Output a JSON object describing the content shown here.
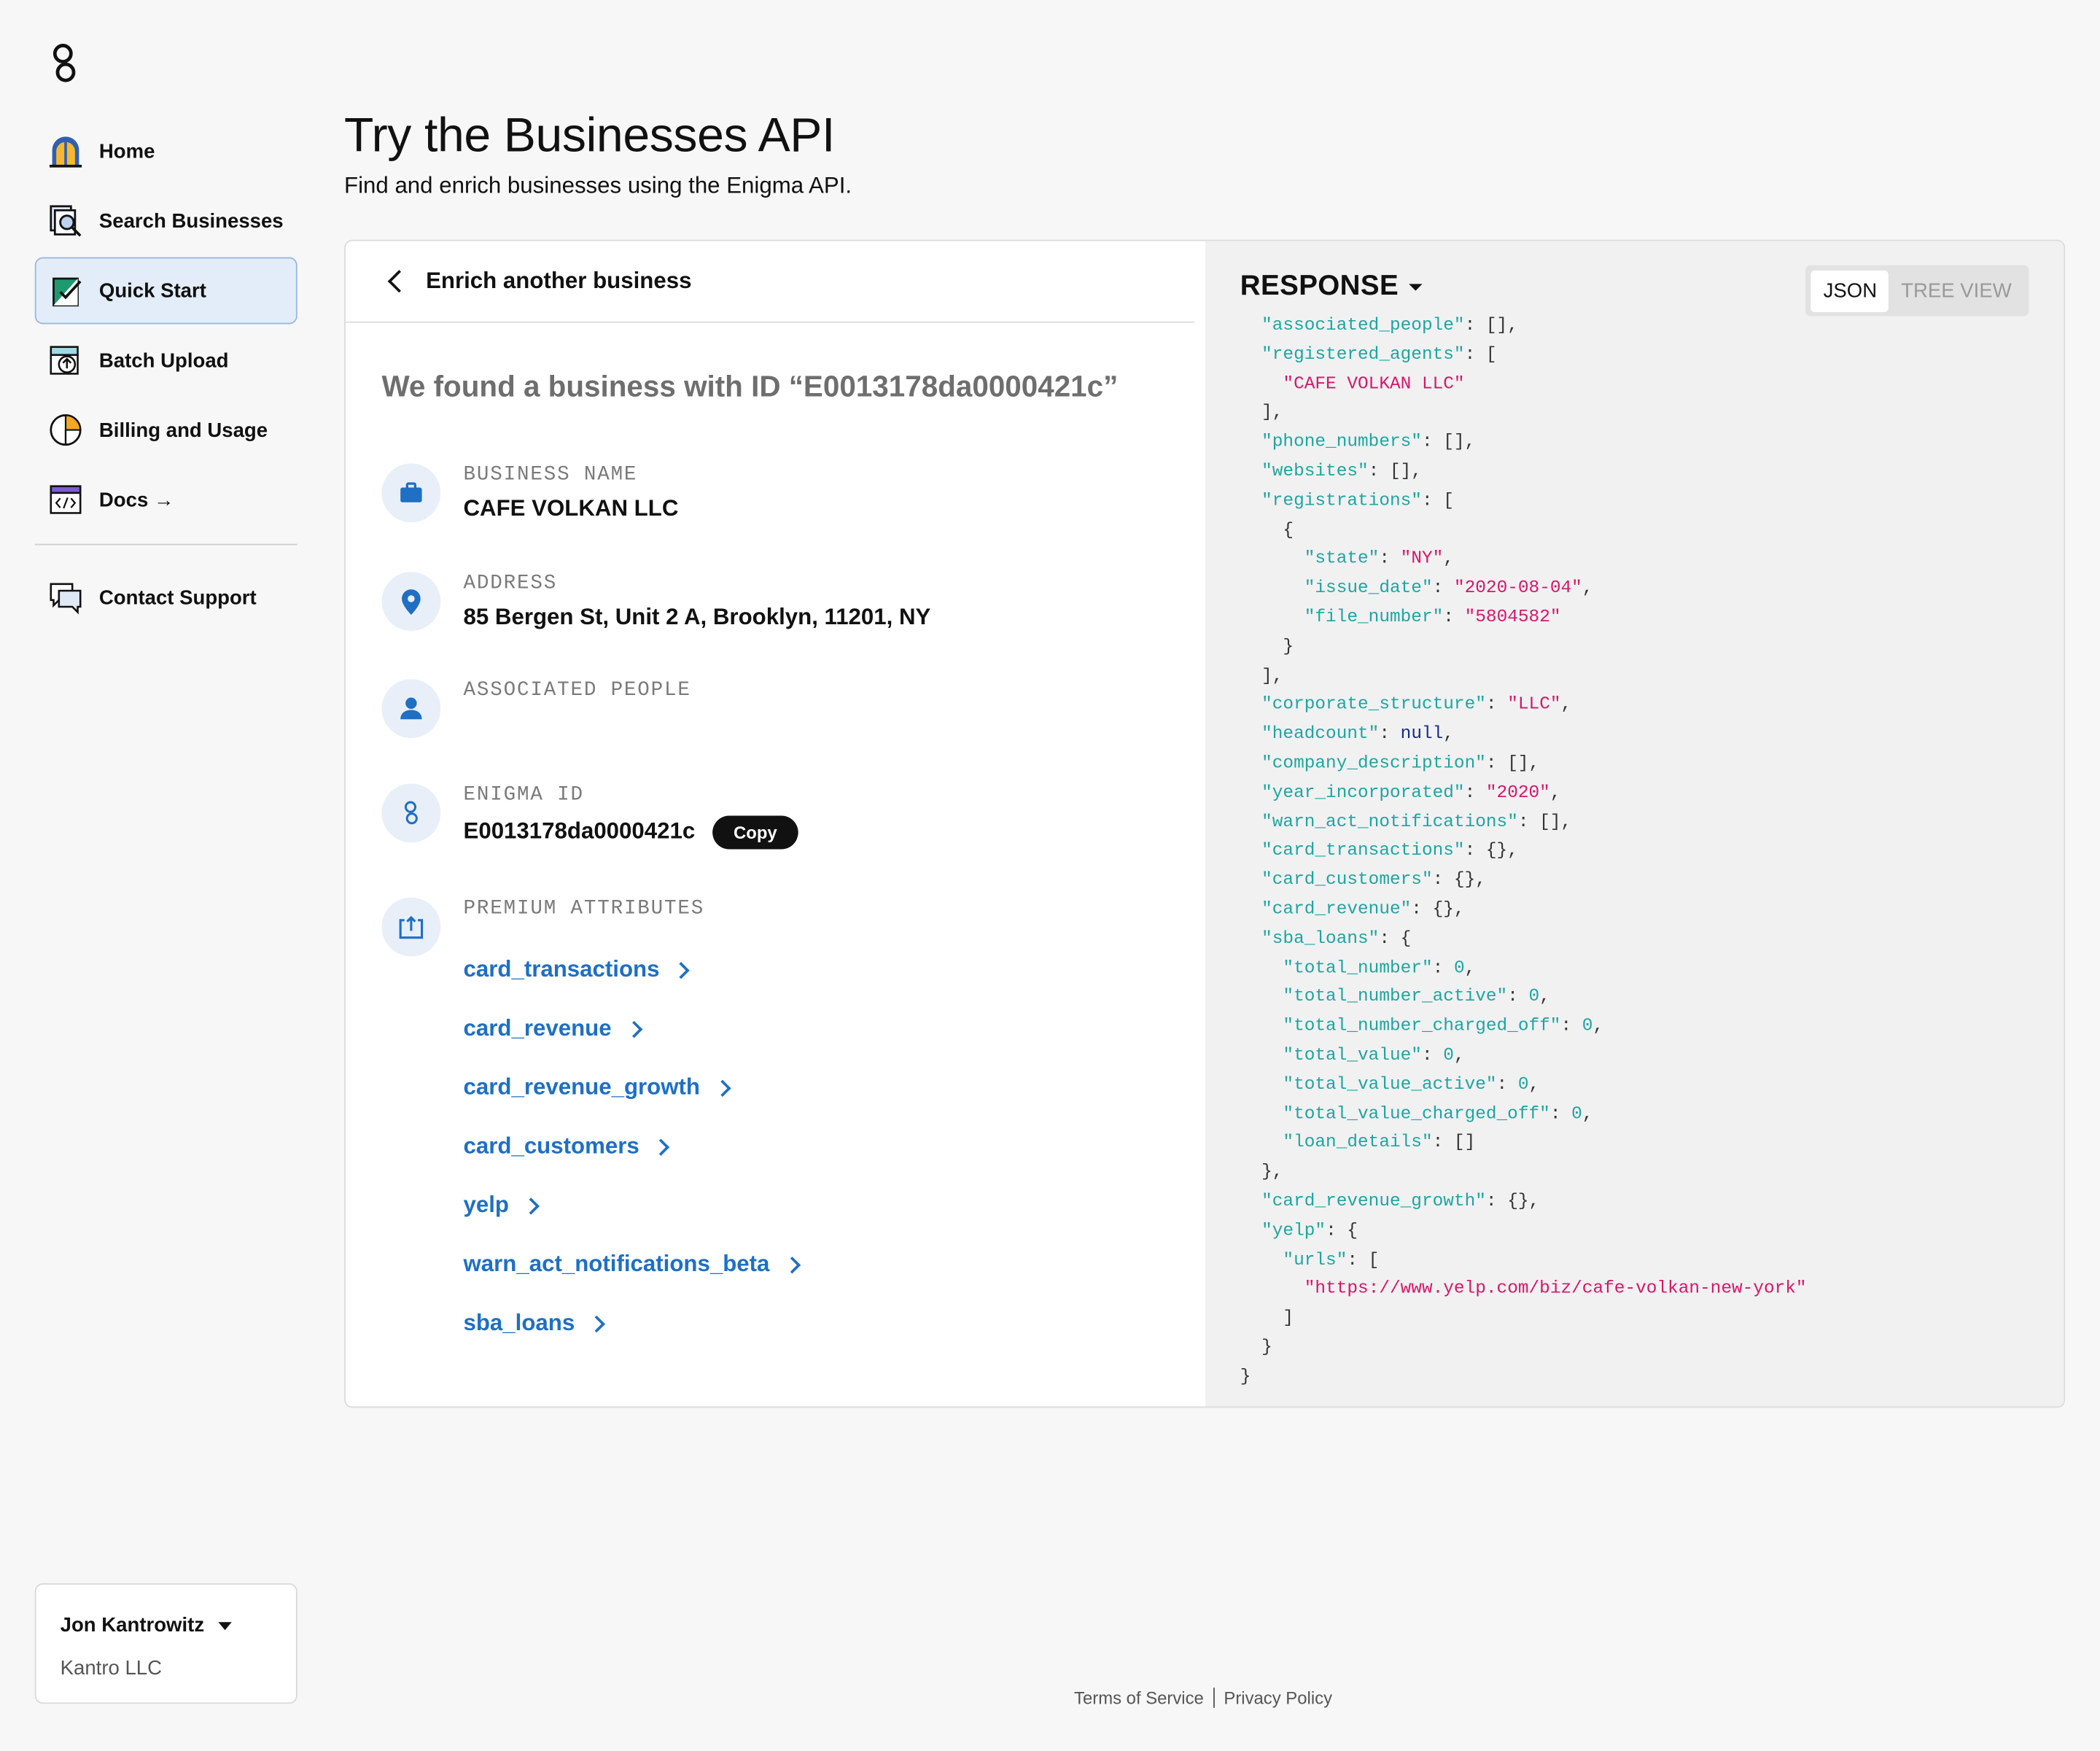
{
  "sidebar": {
    "logo_icon": "enigma-logo-icon",
    "items": [
      {
        "label": "Home",
        "icon": "home-icon"
      },
      {
        "label": "Search Businesses",
        "icon": "search-businesses-icon"
      },
      {
        "label": "Quick Start",
        "icon": "quick-start-icon",
        "active": true
      },
      {
        "label": "Batch Upload",
        "icon": "batch-upload-icon"
      },
      {
        "label": "Billing and Usage",
        "icon": "billing-icon"
      },
      {
        "label": "Docs →",
        "icon": "docs-icon"
      },
      {
        "label": "Contact Support",
        "icon": "contact-support-icon"
      }
    ],
    "user": {
      "name": "Jon Kantrowitz",
      "org": "Kantro LLC"
    }
  },
  "header": {
    "title": "Try the Businesses API",
    "subtitle": "Find and enrich businesses using the Enigma API."
  },
  "result": {
    "back_label": "Enrich another business",
    "found_text": "We found a business with ID “E0013178da0000421c”",
    "fields": {
      "business_name": {
        "label": "BUSINESS NAME",
        "value": "CAFE VOLKAN LLC",
        "icon": "briefcase-icon"
      },
      "address": {
        "label": "ADDRESS",
        "value": "85 Bergen St, Unit 2 A, Brooklyn, 11201, NY",
        "icon": "map-pin-icon"
      },
      "associated_people": {
        "label": "ASSOCIATED PEOPLE",
        "value": "",
        "icon": "person-icon"
      },
      "enigma_id": {
        "label": "ENIGMA ID",
        "value": "E0013178da0000421c",
        "icon": "enigma-id-icon",
        "copy_label": "Copy"
      },
      "premium": {
        "label": "PREMIUM ATTRIBUTES",
        "icon": "premium-attributes-icon"
      }
    },
    "premium_links": [
      "card_transactions",
      "card_revenue",
      "card_revenue_growth",
      "card_customers",
      "yelp",
      "warn_act_notifications_beta",
      "sba_loans"
    ]
  },
  "response": {
    "title": "RESPONSE",
    "toggle": {
      "json": "JSON",
      "tree": "TREE VIEW",
      "selected": "JSON"
    },
    "lines": [
      "  \"associated_people\": [],",
      "  \"registered_agents\": [",
      "    \"CAFE VOLKAN LLC\"",
      "  ],",
      "  \"phone_numbers\": [],",
      "  \"websites\": [],",
      "  \"registrations\": [",
      "    {",
      "      \"state\": \"NY\",",
      "      \"issue_date\": \"2020-08-04\",",
      "      \"file_number\": \"5804582\"",
      "    }",
      "  ],",
      "  \"corporate_structure\": \"LLC\",",
      "  \"headcount\": null,",
      "  \"company_description\": [],",
      "  \"year_incorporated\": \"2020\",",
      "  \"warn_act_notifications\": [],",
      "  \"card_transactions\": {},",
      "  \"card_customers\": {},",
      "  \"card_revenue\": {},",
      "  \"sba_loans\": {",
      "    \"total_number\": 0,",
      "    \"total_number_active\": 0,",
      "    \"total_number_charged_off\": 0,",
      "    \"total_value\": 0,",
      "    \"total_value_active\": 0,",
      "    \"total_value_charged_off\": 0,",
      "    \"loan_details\": []",
      "  },",
      "  \"card_revenue_growth\": {},",
      "  \"yelp\": {",
      "    \"urls\": [",
      "      \"https://www.yelp.com/biz/cafe-volkan-new-york\"",
      "    ]",
      "  }",
      "}"
    ]
  },
  "footer": {
    "terms": "Terms of Service",
    "privacy": "Privacy Policy"
  },
  "colors": {
    "accent": "#1f6fc4",
    "key": "#1fa5a0",
    "string": "#d4176a",
    "null": "#1a2a8a"
  }
}
